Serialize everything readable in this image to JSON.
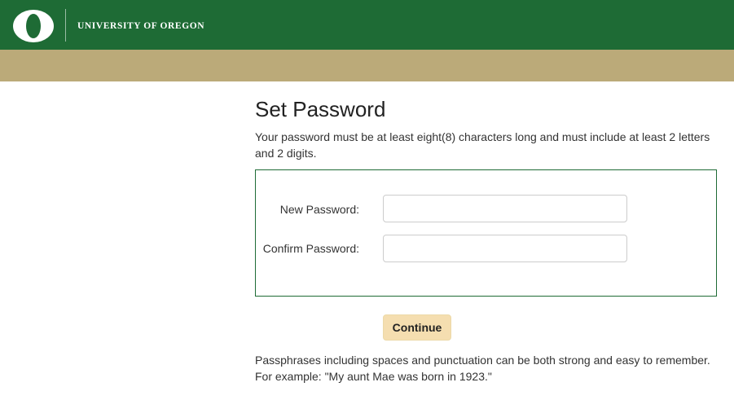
{
  "header": {
    "logo_icon": "uo-o-logo-icon",
    "university_name": "UNIVERSITY OF OREGON",
    "colors": {
      "green": "#1e6b35",
      "tan": "#bbaa79"
    }
  },
  "main": {
    "title": "Set Password",
    "intro": "Your password must be at least eight(8) characters long and must include at least 2 letters and 2 digits.",
    "form": {
      "new_password_label": "New Password:",
      "new_password_value": "",
      "confirm_password_label": "Confirm Password:",
      "confirm_password_value": ""
    },
    "continue_label": "Continue",
    "hint_line1": "Passphrases including spaces and punctuation can be both strong and easy to remember.",
    "hint_line2": "For example: \"My aunt Mae was born in 1923.\""
  }
}
